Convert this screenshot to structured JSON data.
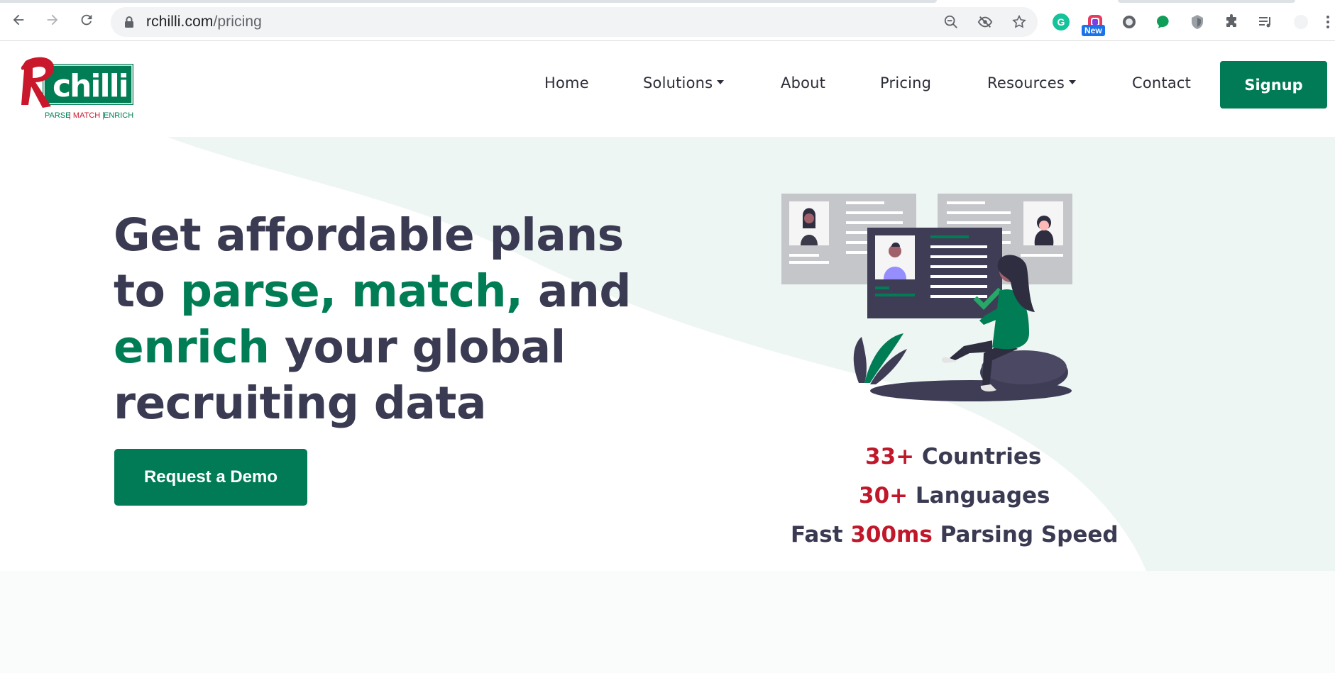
{
  "browser": {
    "url_host": "rchilli.com",
    "url_path": "/pricing",
    "extension_badge": "New"
  },
  "header": {
    "logo": {
      "brand": "Rchilli",
      "tagline": "PARSE | MATCH | ENRICH"
    },
    "nav": [
      {
        "label": "Home",
        "dropdown": false
      },
      {
        "label": "Solutions",
        "dropdown": true
      },
      {
        "label": "About",
        "dropdown": false
      },
      {
        "label": "Pricing",
        "dropdown": false
      },
      {
        "label": "Resources",
        "dropdown": true
      },
      {
        "label": "Contact",
        "dropdown": false
      }
    ],
    "signup_label": "Signup"
  },
  "hero": {
    "headline": {
      "line1": "Get affordable plans",
      "line2_a": "to ",
      "line2_green": "parse, match,",
      "line2_b": " and",
      "line3_green": "enrich",
      "line3_b": " your global",
      "line4": "recruiting data"
    },
    "cta_label": "Request a Demo",
    "stats": [
      {
        "highlight": "33+",
        "rest": " Countries"
      },
      {
        "highlight": "30+",
        "rest": " Languages"
      },
      {
        "prefix": "Fast ",
        "highlight": "300ms",
        "rest": " Parsing Speed"
      }
    ]
  },
  "colors": {
    "brand_green": "#007b55",
    "highlight_red": "#c0172a",
    "headline_dark": "#3a3a52",
    "hero_tint": "#eef6f3"
  }
}
